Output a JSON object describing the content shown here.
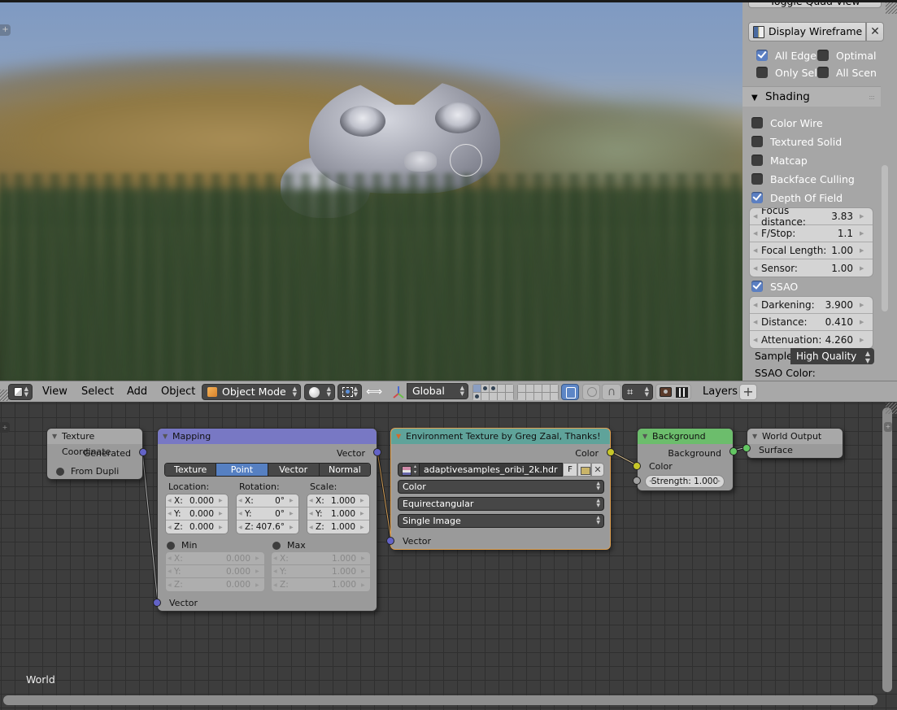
{
  "viewport": {
    "description": "Blurred 3D viewport render: Suzanne monkey heads in grass with hills, depth of field"
  },
  "sidebar": {
    "toggle_quad_view": "Toggle Quad View",
    "display_wireframe": "Display Wireframe",
    "display_wireframe_close": "✕",
    "overlay_options": [
      {
        "label": "All Edge",
        "checked": true
      },
      {
        "label": "Optimal",
        "checked": false
      },
      {
        "label": "Only Sel",
        "checked": false
      },
      {
        "label": "All Scen",
        "checked": false
      }
    ],
    "shading_panel": {
      "title": "Shading",
      "grip": "::::",
      "options": [
        {
          "label": "Color Wire",
          "checked": false
        },
        {
          "label": "Textured Solid",
          "checked": false
        },
        {
          "label": "Matcap",
          "checked": false
        },
        {
          "label": "Backface Culling",
          "checked": false
        },
        {
          "label": "Depth Of Field",
          "checked": true
        }
      ],
      "dof_fields": [
        {
          "label": "Focus distance:",
          "value": "3.83"
        },
        {
          "label": "F/Stop:",
          "value": "1.1"
        },
        {
          "label": "Focal Length:",
          "value": "1.00"
        },
        {
          "label": "Sensor:",
          "value": "1.00"
        }
      ],
      "ssao": {
        "label": "SSAO",
        "checked": true
      },
      "ssao_fields": [
        {
          "label": "Darkening:",
          "value": "3.900"
        },
        {
          "label": "Distance:",
          "value": "0.410"
        },
        {
          "label": "Attenuation:",
          "value": "4.260"
        }
      ],
      "samples_label": "Sample",
      "samples_value": "High Quality",
      "ssao_color_label": "SSAO Color:"
    }
  },
  "header": {
    "menus": [
      "View",
      "Select",
      "Add",
      "Object"
    ],
    "mode": "Object Mode",
    "orientation": "Global",
    "layers_label": "Layers",
    "add_layer": "+",
    "manipulator_icon": "⟺",
    "magnet_icon": "∩",
    "snap_icon": "⌗"
  },
  "node_editor": {
    "tree_label": "World",
    "nodes": {
      "texture_coordinate": {
        "title": "Texture Coordinate",
        "output": "Generated",
        "from_dupli": "From Dupli"
      },
      "mapping": {
        "title": "Mapping",
        "output": "Vector",
        "types": [
          {
            "label": "Texture",
            "active": false
          },
          {
            "label": "Point",
            "active": true
          },
          {
            "label": "Vector",
            "active": false
          },
          {
            "label": "Normal",
            "active": false
          }
        ],
        "location_label": "Location:",
        "rotation_label": "Rotation:",
        "scale_label": "Scale:",
        "location": [
          {
            "axis": "X:",
            "value": "0.000"
          },
          {
            "axis": "Y:",
            "value": "0.000"
          },
          {
            "axis": "Z:",
            "value": "0.000"
          }
        ],
        "rotation": [
          {
            "axis": "X:",
            "value": "0°"
          },
          {
            "axis": "Y:",
            "value": "0°"
          },
          {
            "axis": "Z:",
            "value": "407.6°"
          }
        ],
        "scale": [
          {
            "axis": "X:",
            "value": "1.000"
          },
          {
            "axis": "Y:",
            "value": "1.000"
          },
          {
            "axis": "Z:",
            "value": "1.000"
          }
        ],
        "min_label": "Min",
        "max_label": "Max",
        "min": [
          {
            "axis": "X:",
            "value": "0.000"
          },
          {
            "axis": "Y:",
            "value": "0.000"
          },
          {
            "axis": "Z:",
            "value": "0.000"
          }
        ],
        "max": [
          {
            "axis": "X:",
            "value": "1.000"
          },
          {
            "axis": "Y:",
            "value": "1.000"
          },
          {
            "axis": "Z:",
            "value": "1.000"
          }
        ],
        "input": "Vector"
      },
      "environment_texture": {
        "title": "Environment Texture by Greg Zaal, Thanks!",
        "output": "Color",
        "image_name": "adaptivesamples_oribi_2k.hdr",
        "fake_user": "F",
        "unlink": "✕",
        "color_space": "Color",
        "projection": "Equirectangular",
        "source": "Single Image",
        "input": "Vector"
      },
      "background": {
        "title": "Background",
        "output": "Background",
        "input_color": "Color",
        "strength": "Strength: 1.000"
      },
      "world_output": {
        "title": "World Output",
        "input": "Surface"
      }
    },
    "colors": {
      "mapping_header": "#7878c4",
      "env_header": "#5fa39a",
      "background_header": "#6cbd6c",
      "output_header": "#9a9a9a",
      "selected_outline": "#e0a050"
    }
  }
}
